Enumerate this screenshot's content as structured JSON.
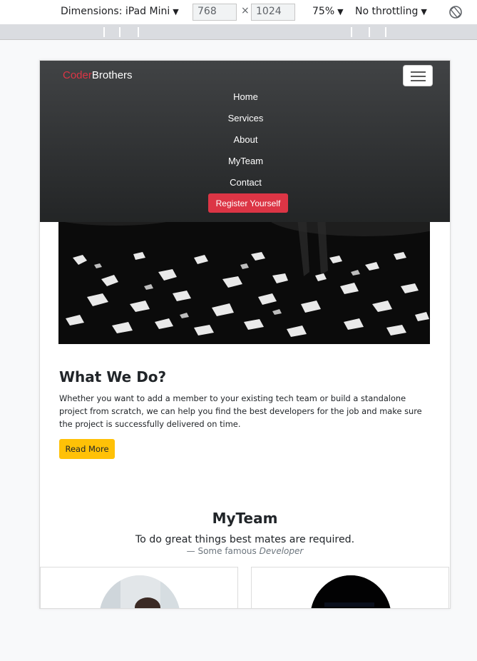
{
  "devtools": {
    "dimensions_label": "Dimensions: iPad Mini",
    "width_value": "768",
    "times": "×",
    "height_value": "1024",
    "zoom_label": "75%",
    "throttle_label": "No throttling",
    "caret": "▼"
  },
  "brand": {
    "part1": "Coder",
    "part2": "Brothers"
  },
  "nav": {
    "links": [
      "Home",
      "Services",
      "About",
      "MyTeam",
      "Contact"
    ],
    "register_label": "Register Yourself"
  },
  "what_we_do": {
    "title": "What We Do?",
    "text": "Whether you want to add a member to your existing tech team or build a standalone project from scratch, we can help you find the best developers for the job and make sure the project is successfully delivered on time.",
    "button_label": "Read More"
  },
  "team": {
    "title": "MyTeam",
    "quote": "To do great things best mates are required.",
    "cite_prefix": "— Some famous ",
    "cite_source": "Developer"
  },
  "colors": {
    "brand_red": "#dc3545",
    "navbar_top": "#414345",
    "navbar_bottom": "#232526",
    "read_more": "#ffc107"
  },
  "icons": {
    "menu": "hamburger-icon",
    "rotate": "rotate-icon"
  }
}
